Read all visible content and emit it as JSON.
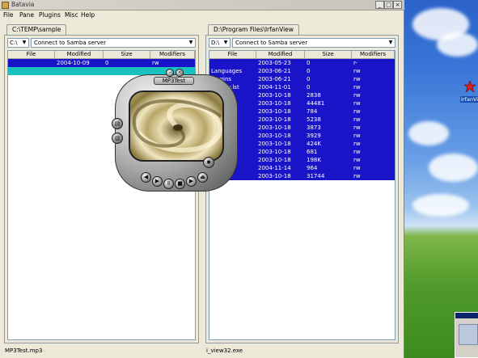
{
  "window": {
    "title": "Batavia"
  },
  "menu": [
    "File",
    "Pane",
    "Plugins",
    "Misc",
    "Help"
  ],
  "left_pane": {
    "tab": "C:\\TEMP\\sample",
    "drive": "C:\\",
    "connect": "Connect to Samba server",
    "columns": [
      "File",
      "Modified",
      "Size",
      "Modifiers"
    ],
    "rows": [
      {
        "file": "",
        "modified": "2004-10-09",
        "size": "0",
        "modifiers": "rw"
      },
      {
        "file": "",
        "modified": "",
        "size": "",
        "modifiers": ""
      }
    ],
    "status": "MP3Test.mp3"
  },
  "right_pane": {
    "tab": "D:\\Program Files\\IrfanView",
    "drive": "D:\\",
    "connect": "Connect to Samba server",
    "columns": [
      "File",
      "Modified",
      "Size",
      "Modifiers"
    ],
    "rows": [
      {
        "file": "",
        "modified": "2003-05-23",
        "size": "0",
        "modifiers": "r-"
      },
      {
        "file": "Languages",
        "modified": "2003-06-21",
        "size": "0",
        "modifiers": "rw"
      },
      {
        "file": "Plugins",
        "modified": "2003-06-21",
        "size": "0",
        "modifiers": "rw"
      },
      {
        "file": "...show.lst",
        "modified": "2004-11-01",
        "size": "0",
        "modifiers": "rw"
      },
      {
        "file": "...txt",
        "modified": "2003-10-18",
        "size": "2838",
        "modifiers": "rw"
      },
      {
        "file": "...s.txt",
        "modified": "2003-10-18",
        "size": "44481",
        "modifiers": "rw"
      },
      {
        "file": "...s.txt",
        "modified": "2003-10-18",
        "size": "784",
        "modifiers": "rw"
      },
      {
        "file": "",
        "modified": "2003-10-18",
        "size": "5238",
        "modifiers": "rw"
      },
      {
        "file": "",
        "modified": "2003-10-18",
        "size": "3873",
        "modifiers": "rw"
      },
      {
        "file": "",
        "modified": "2003-10-18",
        "size": "3929",
        "modifiers": "rw"
      },
      {
        "file": "",
        "modified": "2003-10-18",
        "size": "424K",
        "modifiers": "rw"
      },
      {
        "file": "...m",
        "modified": "2003-10-18",
        "size": "681",
        "modifiers": "rw"
      },
      {
        "file": "",
        "modified": "2003-10-18",
        "size": "198K",
        "modifiers": "rw"
      },
      {
        "file": "",
        "modified": "2004-11-14",
        "size": "964",
        "modifiers": "rw"
      },
      {
        "file": "...ll.exe",
        "modified": "2003-10-18",
        "size": "31744",
        "modifiers": "rw"
      }
    ],
    "status": "i_view32.exe"
  },
  "player": {
    "title": "MP3Test",
    "button_icons": [
      "minimize-icon",
      "close-icon",
      "playlist-icon",
      "equalizer-icon",
      "rewind-icon",
      "play-icon",
      "pause-icon",
      "stop-icon",
      "forward-icon",
      "eject-icon",
      "settings-icon"
    ]
  },
  "desktop": {
    "icon_label": "IrfanVi"
  }
}
